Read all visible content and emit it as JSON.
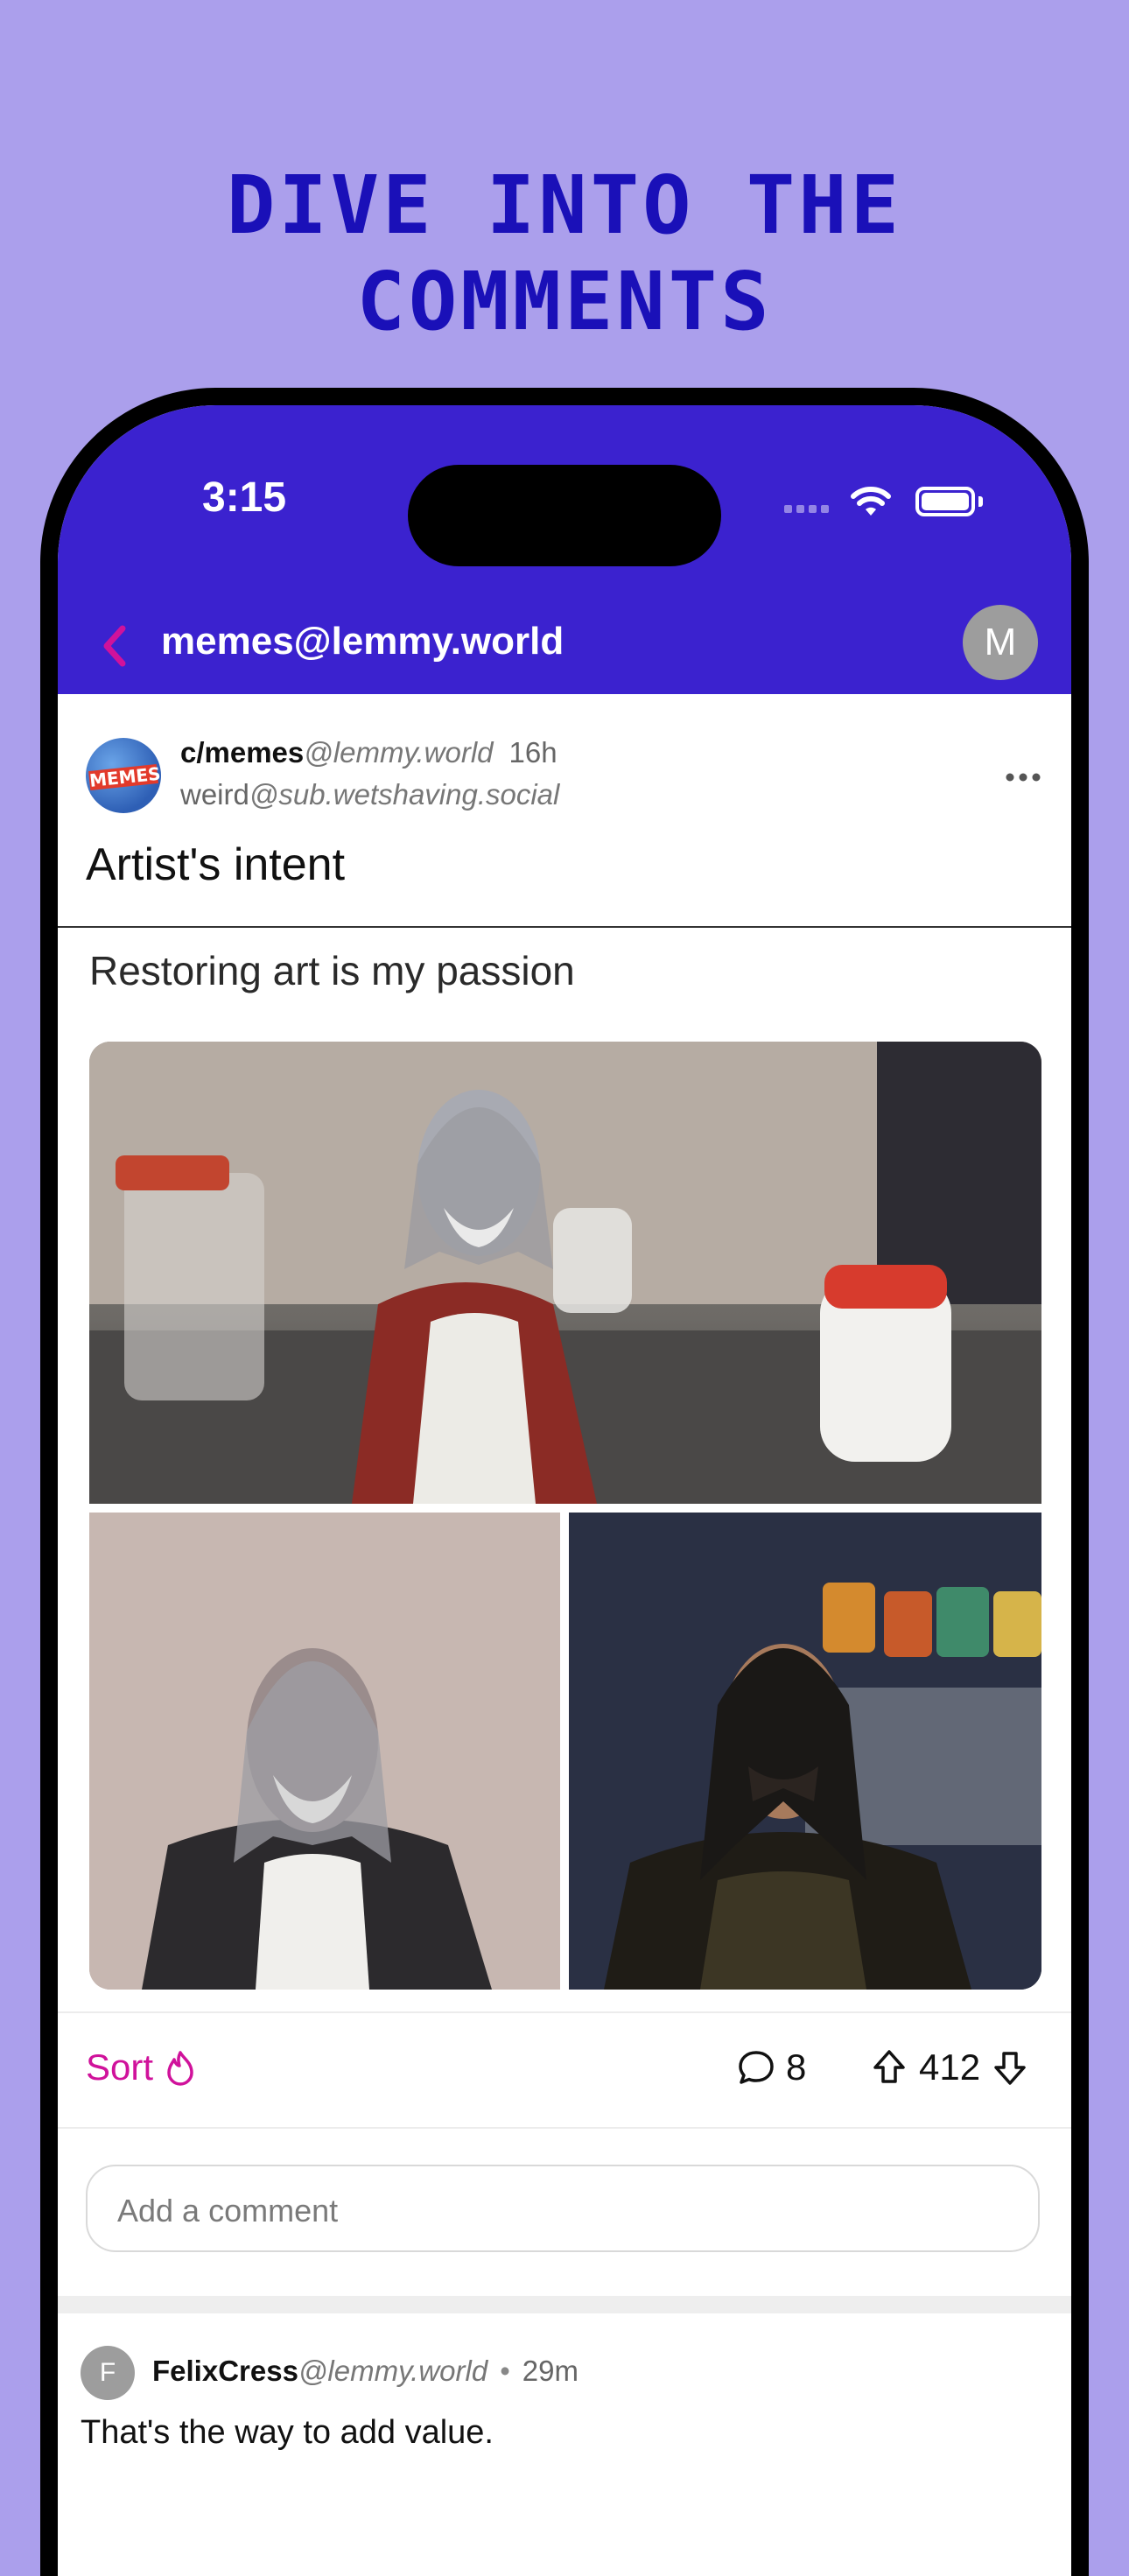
{
  "headline": "DIVE INTO THE COMMENTS",
  "status_bar": {
    "time": "3:15"
  },
  "navbar": {
    "title": "memes@lemmy.world",
    "avatar_letter": "M"
  },
  "post": {
    "community_icon_text": "MEMES",
    "community_name": "c/memes",
    "community_instance": "@lemmy.world",
    "age": "16h",
    "author_name": "weird",
    "author_instance": "@sub.wetshaving.social",
    "title": "Artist's intent",
    "image_caption": "Restoring art is my passion"
  },
  "actions": {
    "sort_label": "Sort",
    "comment_count": "8",
    "score": "412"
  },
  "comment_input": {
    "placeholder": "Add a comment"
  },
  "comments": [
    {
      "avatar_letter": "F",
      "user": "FelixCress",
      "instance": "@lemmy.world",
      "separator": "•",
      "age": "29m",
      "body": "That's the way to add value."
    }
  ],
  "colors": {
    "background": "#ab9fec",
    "headline": "#1a10b8",
    "header": "#3b22cf",
    "accent": "#d0129b"
  },
  "icons": [
    "back-chevron-icon",
    "ellipsis-icon",
    "flame-icon",
    "comment-bubble-icon",
    "upvote-arrow-icon",
    "downvote-arrow-icon",
    "wifi-icon",
    "battery-icon"
  ]
}
